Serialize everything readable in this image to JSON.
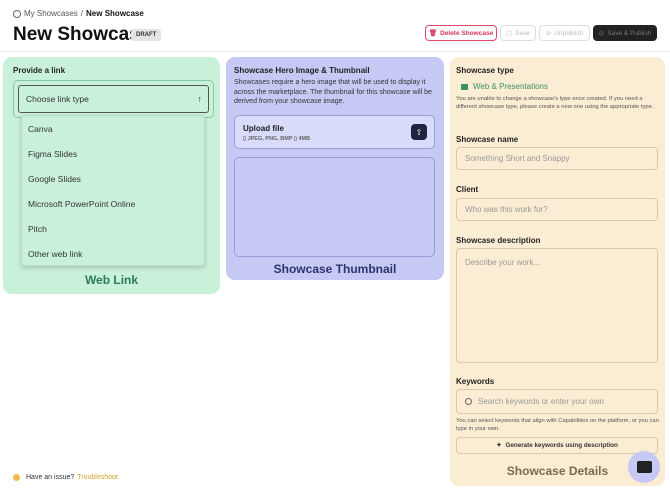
{
  "breadcrumb": {
    "parent": "My Showcases",
    "separator": "/",
    "current": "New Showcase"
  },
  "page": {
    "title": "New Showcase",
    "status_badge": "DRAFT"
  },
  "actions": {
    "delete": "Delete Showcase",
    "save": "Save",
    "unpublish": "Unpublish",
    "save_publish": "Save & Publish"
  },
  "link_card": {
    "label": "Provide a link",
    "select_placeholder": "Choose link type",
    "options": [
      "Canva",
      "Figma Slides",
      "Google Slides",
      "Microsoft PowerPoint Online",
      "Pitch",
      "Other web link"
    ],
    "caption": "Web Link"
  },
  "hero_card": {
    "label": "Showcase Hero Image & Thumbnail",
    "description": "Showcases require a hero image that will be used to display it across the marketplace. The thumbnail for this showcase will be derived from your showcase image.",
    "upload_title": "Upload file",
    "upload_formats": "JPEG, PNG, BMP",
    "upload_size": "4MB",
    "caption": "Showcase Thumbnail"
  },
  "details": {
    "type_label": "Showcase type",
    "type_value": "Web & Presentations",
    "type_note": "You are unable to change a showcase's type once created. If you need a different showcase type, please create a new one using the appropriate type.",
    "name_label": "Showcase name",
    "name_placeholder": "Something Short and Snappy",
    "client_label": "Client",
    "client_placeholder": "Who was this work for?",
    "desc_label": "Showcase description",
    "desc_placeholder": "Describe your work...",
    "keywords_label": "Keywords",
    "keywords_placeholder": "Search keywords or enter your own",
    "keywords_note": "You can select keywords that align with Capabilities on the platform, or you can type in your own.",
    "generate_button": "Generate keywords using description",
    "caption": "Showcase Details"
  },
  "footer": {
    "issue_text": "Have an issue?",
    "troubleshoot_link": "Troubleshoot"
  },
  "colors": {
    "link_card": "#c9f1da",
    "hero_card": "#c7c9f5",
    "details_card": "#fbedd4",
    "danger": "#d8345c"
  }
}
